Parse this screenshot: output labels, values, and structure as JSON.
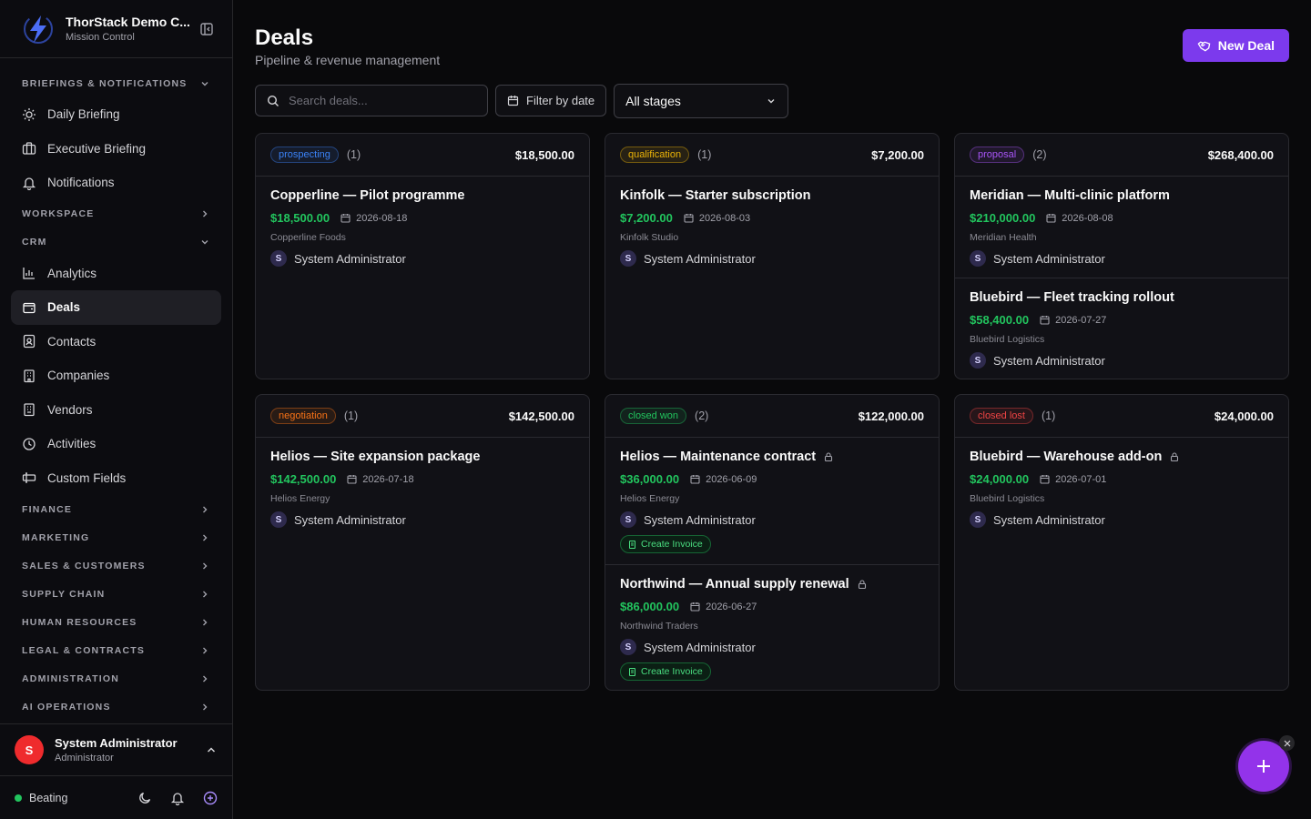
{
  "brand": {
    "name": "ThorStack Demo C...",
    "subtitle": "Mission Control"
  },
  "sidebar": {
    "briefings": {
      "label": "BRIEFINGS & NOTIFICATIONS",
      "items": [
        "Daily Briefing",
        "Executive Briefing",
        "Notifications"
      ]
    },
    "workspace": {
      "label": "WORKSPACE"
    },
    "crm": {
      "label": "CRM",
      "items": [
        "Analytics",
        "Deals",
        "Contacts",
        "Companies",
        "Vendors",
        "Activities",
        "Custom Fields"
      ]
    },
    "sections": [
      "FINANCE",
      "MARKETING",
      "SALES & CUSTOMERS",
      "SUPPLY CHAIN",
      "HUMAN RESOURCES",
      "LEGAL & CONTRACTS",
      "ADMINISTRATION",
      "AI OPERATIONS"
    ]
  },
  "user": {
    "initial": "S",
    "name": "System Administrator",
    "role": "Administrator"
  },
  "status": {
    "label": "Beating"
  },
  "page": {
    "title": "Deals",
    "subtitle": "Pipeline & revenue management",
    "new_button": "New Deal"
  },
  "filters": {
    "search_placeholder": "Search deals...",
    "date_button": "Filter by date",
    "stage_select": "All stages"
  },
  "columns": [
    {
      "stage": "prospecting",
      "count": "(1)",
      "total": "$18,500.00",
      "color": "#3b82f6",
      "deals": [
        {
          "title": "Copperline — Pilot programme",
          "amount": "$18,500.00",
          "date": "2026-08-18",
          "company": "Copperline Foods",
          "owner": "System Administrator",
          "owner_initial": "S"
        }
      ]
    },
    {
      "stage": "qualification",
      "count": "(1)",
      "total": "$7,200.00",
      "color": "#eab308",
      "deals": [
        {
          "title": "Kinfolk — Starter subscription",
          "amount": "$7,200.00",
          "date": "2026-08-03",
          "company": "Kinfolk Studio",
          "owner": "System Administrator",
          "owner_initial": "S"
        }
      ]
    },
    {
      "stage": "proposal",
      "count": "(2)",
      "total": "$268,400.00",
      "color": "#a855f7",
      "deals": [
        {
          "title": "Meridian — Multi-clinic platform",
          "amount": "$210,000.00",
          "date": "2026-08-08",
          "company": "Meridian Health",
          "owner": "System Administrator",
          "owner_initial": "S"
        },
        {
          "title": "Bluebird — Fleet tracking rollout",
          "amount": "$58,400.00",
          "date": "2026-07-27",
          "company": "Bluebird Logistics",
          "owner": "System Administrator",
          "owner_initial": "S"
        }
      ]
    },
    {
      "stage": "negotiation",
      "count": "(1)",
      "total": "$142,500.00",
      "color": "#f97316",
      "deals": [
        {
          "title": "Helios — Site expansion package",
          "amount": "$142,500.00",
          "date": "2026-07-18",
          "company": "Helios Energy",
          "owner": "System Administrator",
          "owner_initial": "S"
        }
      ]
    },
    {
      "stage": "closed won",
      "count": "(2)",
      "total": "$122,000.00",
      "color": "#22c55e",
      "deals": [
        {
          "title": "Helios — Maintenance contract",
          "amount": "$36,000.00",
          "date": "2026-06-09",
          "company": "Helios Energy",
          "owner": "System Administrator",
          "owner_initial": "S",
          "locked": true,
          "action": "Create Invoice"
        },
        {
          "title": "Northwind — Annual supply renewal",
          "amount": "$86,000.00",
          "date": "2026-06-27",
          "company": "Northwind Traders",
          "owner": "System Administrator",
          "owner_initial": "S",
          "locked": true,
          "action": "Create Invoice"
        }
      ]
    },
    {
      "stage": "closed lost",
      "count": "(1)",
      "total": "$24,000.00",
      "color": "#ef4444",
      "deals": [
        {
          "title": "Bluebird — Warehouse add-on",
          "amount": "$24,000.00",
          "date": "2026-07-01",
          "company": "Bluebird Logistics",
          "owner": "System Administrator",
          "owner_initial": "S",
          "locked": true
        }
      ]
    }
  ],
  "colors": {
    "accent": "#7c3aed",
    "fab": "#9333ea",
    "amount": "#22c55e",
    "avatar": "#ef2b2d"
  }
}
